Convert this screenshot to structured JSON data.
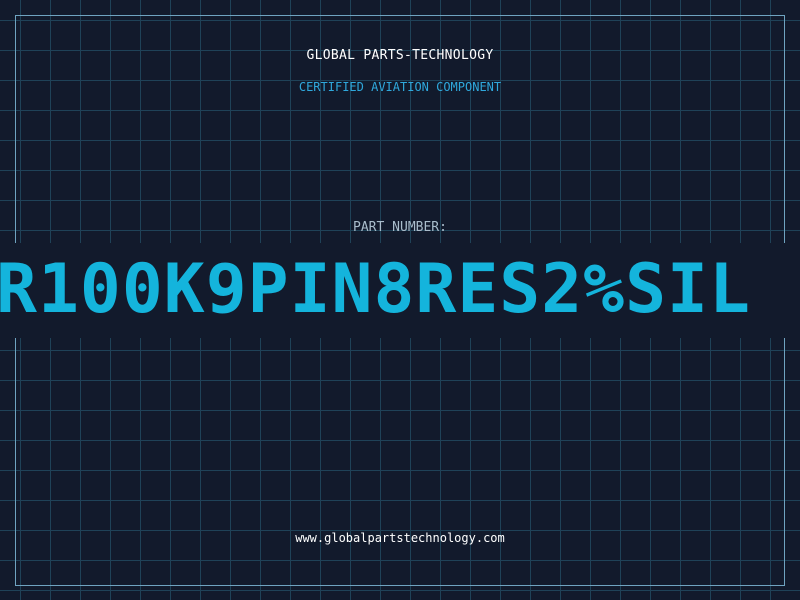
{
  "header": {
    "company_name": "GLOBAL PARTS-TECHNOLOGY",
    "subtitle": "CERTIFIED AVIATION COMPONENT"
  },
  "part": {
    "label": "PART NUMBER:",
    "number": "R100K9PIN8RES2%SIL"
  },
  "footer": {
    "website": "www.globalpartstechnology.com"
  },
  "colors": {
    "background": "#121a2c",
    "grid": "#1f4258",
    "frame": "#6fa3c0",
    "accent": "#14b4dc",
    "subtitle": "#2fa8dc"
  }
}
